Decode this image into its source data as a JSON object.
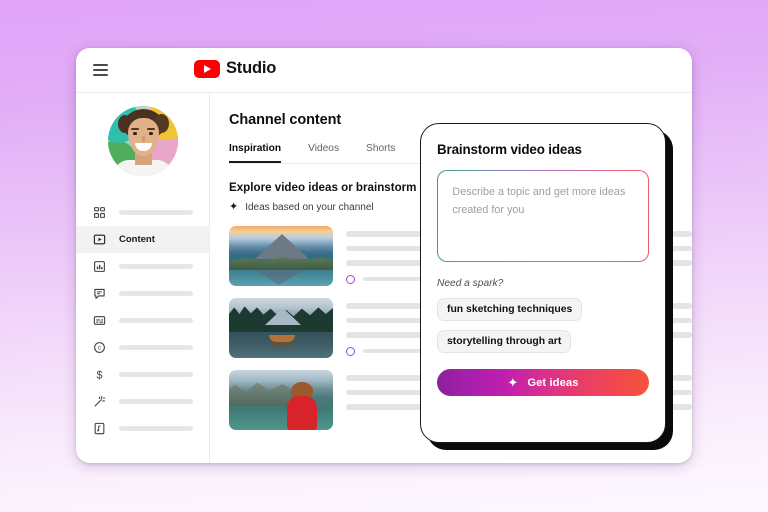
{
  "window": {
    "topbar": {
      "menu_icon": "hamburger-menu-icon",
      "brand_icon": "youtube-play-icon",
      "brand_label": "Studio",
      "search": {
        "icon": "search-icon",
        "value": "",
        "placeholder": ""
      }
    }
  },
  "sidebar": {
    "avatar": "channel-avatar",
    "items": [
      {
        "icon": "dashboard-grid-icon",
        "label": "",
        "active": false
      },
      {
        "icon": "content-play-icon",
        "label": "Content",
        "active": true
      },
      {
        "icon": "analytics-bar-chart-icon",
        "label": "",
        "active": false
      },
      {
        "icon": "comments-speech-bubble-icon",
        "label": "",
        "active": false
      },
      {
        "icon": "subtitles-icon",
        "label": "",
        "active": false
      },
      {
        "icon": "copyright-icon",
        "label": "",
        "active": false
      },
      {
        "icon": "earn-dollar-icon",
        "label": "",
        "active": false
      },
      {
        "icon": "customization-wand-icon",
        "label": "",
        "active": false
      },
      {
        "icon": "audio-library-note-icon",
        "label": "",
        "active": false
      }
    ]
  },
  "main": {
    "page_title": "Channel content",
    "tabs": [
      {
        "label": "Inspiration",
        "active": true
      },
      {
        "label": "Videos",
        "active": false
      },
      {
        "label": "Shorts",
        "active": false
      }
    ],
    "explore_heading": "Explore video ideas or brainstorm you",
    "ideas_sub": {
      "icon": "sparkle-icon",
      "label": "Ideas based on your channel"
    },
    "videos": [
      {
        "thumbnail": "mountain-lake-sunset-thumbnail"
      },
      {
        "thumbnail": "boat-on-forest-lake-thumbnail"
      },
      {
        "thumbnail": "person-red-jacket-mountain-lake-thumbnail"
      }
    ]
  },
  "dialog": {
    "title": "Brainstorm video ideas",
    "prompt_placeholder": "Describe a topic and get more ideas created for you",
    "prompt_value": "",
    "spark_label": "Need a spark?",
    "chips": [
      "fun sketching techniques",
      "storytelling through art"
    ],
    "cta": {
      "icon": "sparkle-icon",
      "label": "Get ideas"
    }
  },
  "colors": {
    "background_top": "#dfa3f8",
    "background_bottom": "#fdf8ff",
    "youtube_red": "#ff0000",
    "cta_gradient_start": "#8d1f9b",
    "cta_gradient_mid": "#d92f8f",
    "cta_gradient_end": "#f4553f",
    "prompt_border_start": "#3f9e86",
    "prompt_border_end": "#ec5a58",
    "accent_circle": "#9a4fc9",
    "dialog_outline": "#1b1b1b"
  }
}
